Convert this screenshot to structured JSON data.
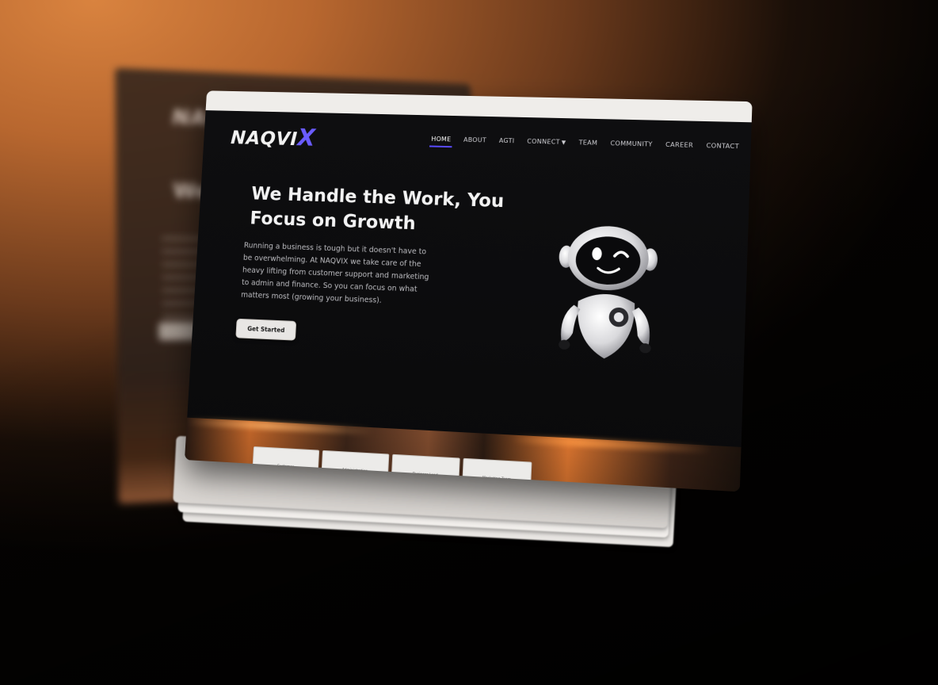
{
  "site": {
    "logo": {
      "text": "NAQVI",
      "accent": "X"
    },
    "nav": {
      "items": [
        {
          "label": "HOME",
          "active": true
        },
        {
          "label": "ABOUT",
          "active": false
        },
        {
          "label": "AGTI",
          "active": false
        },
        {
          "label": "CONNECT",
          "active": false,
          "has_dropdown": true
        },
        {
          "label": "TEAM",
          "active": false
        },
        {
          "label": "COMMUNITY",
          "active": false
        },
        {
          "label": "CAREER",
          "active": false
        },
        {
          "label": "CONTACT",
          "active": false
        }
      ],
      "active_color": "#5a4bff"
    },
    "hero": {
      "title_line1": "We Handle the Work, You",
      "title_line2": "Focus on Growth",
      "paragraph": "Running a business is tough but it doesn't have to be overwhelming. At NAQVIX we take care of the heavy lifting from customer support and marketing to admin and finance. So you can focus on what matters most (growing your business).",
      "cta_label": "Get Started"
    },
    "cards": [
      {
        "label": "Customer"
      },
      {
        "label": "Administration"
      },
      {
        "label": "Business Lead"
      },
      {
        "label": "Marketing Team"
      }
    ],
    "ghost": {
      "logo": "NAQV",
      "title": "We Focu"
    },
    "colors": {
      "background": "#0b0b0c",
      "accent": "#6a5cff",
      "backdrop": "#d9833f"
    }
  }
}
